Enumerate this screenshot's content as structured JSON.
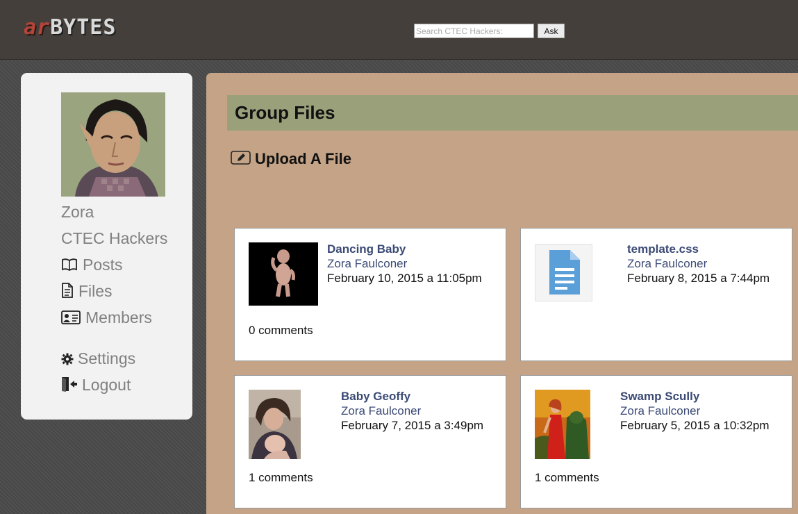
{
  "header": {
    "logo_part1": "ar",
    "logo_part2": "BYTES",
    "search_placeholder": "Search CTEC Hackers:",
    "ask_label": "Ask"
  },
  "sidebar": {
    "user_name": "Zora",
    "group_name": "CTEC Hackers",
    "nav": [
      {
        "label": "Posts",
        "icon": "book-icon"
      },
      {
        "label": "Files",
        "icon": "document-icon"
      },
      {
        "label": "Members",
        "icon": "id-card-icon"
      }
    ],
    "settings_label": "Settings",
    "logout_label": "Logout"
  },
  "main": {
    "title": "Group Files",
    "upload_label": "Upload A File"
  },
  "files": [
    {
      "title": "Dancing Baby",
      "author": "Zora Faulconer",
      "date": "February 10, 2015 a 11:05pm",
      "comments": "0 comments",
      "thumbnail": "dancing-baby-image"
    },
    {
      "title": "template.css",
      "author": "Zora Faulconer",
      "date": "February 8, 2015 a 7:44pm",
      "comments": "",
      "thumbnail": "document-file-icon"
    },
    {
      "title": "Baby Geoffy",
      "author": "Zora Faulconer",
      "date": "February 7, 2015 a 3:49pm",
      "comments": "1 comments",
      "thumbnail": "mother-baby-photo"
    },
    {
      "title": "Swamp Scully",
      "author": "Zora Faulconer",
      "date": "February 5, 2015 a 10:32pm",
      "comments": "1 comments",
      "thumbnail": "swamp-scully-poster"
    }
  ]
}
